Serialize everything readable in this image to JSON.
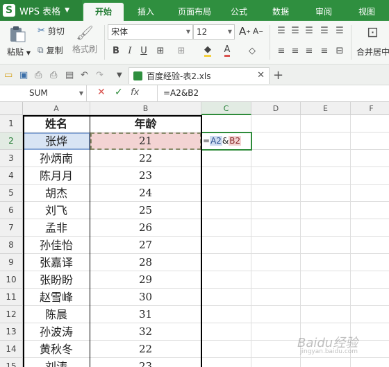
{
  "app": {
    "name": "WPS 表格"
  },
  "tabs": [
    {
      "label": "开始",
      "active": true
    },
    {
      "label": "插入",
      "active": false
    },
    {
      "label": "页面布局",
      "active": false
    },
    {
      "label": "公式",
      "active": false
    },
    {
      "label": "数据",
      "active": false
    },
    {
      "label": "审阅",
      "active": false
    },
    {
      "label": "视图",
      "active": false
    }
  ],
  "ribbon": {
    "paste": "粘贴",
    "cut": "剪切",
    "copy": "复制",
    "format_painter": "格式刷",
    "font_name": "宋体",
    "font_size": "12",
    "merge_center": "合并居中"
  },
  "document": {
    "tab_title": "百度经验-表2.xls"
  },
  "formula_bar": {
    "name_box": "SUM",
    "formula": "=A2&B2"
  },
  "grid": {
    "columns": [
      "A",
      "B",
      "C",
      "D",
      "E",
      "F"
    ],
    "rows": [
      {
        "num": "1",
        "a": "姓名",
        "b": "年龄"
      },
      {
        "num": "2",
        "a": "张烨",
        "b": "21"
      },
      {
        "num": "3",
        "a": "孙炳南",
        "b": "22"
      },
      {
        "num": "4",
        "a": "陈月月",
        "b": "23"
      },
      {
        "num": "5",
        "a": "胡杰",
        "b": "24"
      },
      {
        "num": "6",
        "a": "刘飞",
        "b": "25"
      },
      {
        "num": "7",
        "a": "孟非",
        "b": "26"
      },
      {
        "num": "8",
        "a": "孙佳怡",
        "b": "27"
      },
      {
        "num": "9",
        "a": "张嘉译",
        "b": "28"
      },
      {
        "num": "10",
        "a": "张盼盼",
        "b": "29"
      },
      {
        "num": "11",
        "a": "赵雪峰",
        "b": "30"
      },
      {
        "num": "12",
        "a": "陈晨",
        "b": "31"
      },
      {
        "num": "13",
        "a": "孙波涛",
        "b": "32"
      },
      {
        "num": "14",
        "a": "黄秋冬",
        "b": "22"
      },
      {
        "num": "15",
        "a": "刘涛",
        "b": "23"
      }
    ],
    "active_cell": {
      "eq": "=",
      "ref_a": "A2",
      "amp": "&",
      "ref_b": "B2"
    }
  },
  "watermark": {
    "text": "Baidu经验",
    "sub": "jingyan.baidu.com"
  },
  "colors": {
    "brand_green": "#2f8f3f",
    "ref_a_fill": "#d8e4f4",
    "ref_b_fill": "#f3d3d3"
  }
}
